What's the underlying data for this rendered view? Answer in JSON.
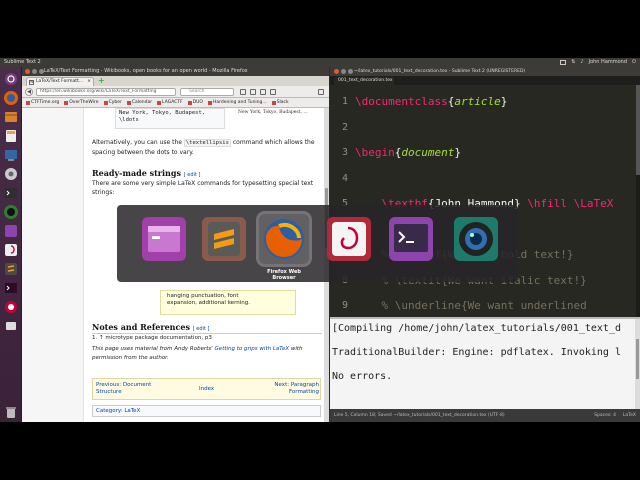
{
  "top_panel": {
    "app_title": "Sublime Text 2",
    "user": "John Hammond"
  },
  "firefox": {
    "window_title": "LaTeX/Text Formatting - Wikibooks, open books for an open world - Mozilla Firefox",
    "tab_label": "LaTeX/Text Formatt...",
    "tab_close": "×",
    "new_tab": "+",
    "url": "https://en.wikibooks.org/wiki/LaTeX/Text_Formatting",
    "search_placeholder": "Search",
    "bookmarks": [
      "CTFTime.org",
      "OverTheWire",
      "Cyber",
      "Calendar",
      "LAGACTF",
      "DUO",
      "Hardening and Tuning...",
      "Slack"
    ],
    "page": {
      "code_block": "New York, Tokyo, Budapest,\n\\ldots",
      "serif_output": "New York, Tokyo, Budapest, ...",
      "para_alt_1": "Alternatively, you can use the",
      "para_alt_code": "\\textellipsis",
      "para_alt_2": "command which allows the spacing between the dots to vary.",
      "ready_made_heading": "Ready-made strings",
      "edit_label": "[ edit ]",
      "ready_made_para": "There are some very simple LaTeX commands for typesetting special text strings:",
      "tip_line1": "hanging punctuation, font",
      "tip_line2": "expansion, additional kerning.",
      "notes_heading": "Notes and References",
      "ref_1": "1. ↑ microtype package documentation, p3",
      "attribution_1": "This page uses material from Andy Roberts'",
      "attribution_link": "Getting to grips with LaTeX",
      "attribution_2": "with permission from the author.",
      "nav_prev": "Previous: Document Structure",
      "nav_index": "Index",
      "nav_next": "Next: Paragraph Formatting",
      "category": "Category: LaTeX"
    }
  },
  "sublime": {
    "window_title": "~/latex_tutorials/001_text_decoration.tex - Sublime Text 2 (UNREGISTERED)",
    "tab_label": "001_text_decoration.tex",
    "code_lines": [
      {
        "num": "1",
        "parts": [
          [
            "kw",
            "\\documentclass"
          ],
          [
            "ind",
            "{"
          ],
          [
            "arg",
            "article"
          ],
          [
            "ind",
            "}"
          ]
        ]
      },
      {
        "num": "2",
        "parts": []
      },
      {
        "num": "3",
        "parts": [
          [
            "kw",
            "\\begin"
          ],
          [
            "ind",
            "{"
          ],
          [
            "arg",
            "document"
          ],
          [
            "ind",
            "}"
          ]
        ]
      },
      {
        "num": "4",
        "parts": []
      },
      {
        "num": "5",
        "parts": [
          [
            "ind",
            "    "
          ],
          [
            "kw",
            "\\textbf"
          ],
          [
            "ind",
            "{John Hammond} "
          ],
          [
            "kw",
            "\\hfill"
          ],
          [
            "ind",
            " "
          ],
          [
            "kw",
            "\\LaTeX"
          ]
        ]
      },
      {
        "num": "6",
        "parts": []
      },
      {
        "num": "7",
        "parts": [
          [
            "cm",
            "    % \\textbf{We want bold text!}"
          ]
        ]
      },
      {
        "num": "8",
        "parts": [
          [
            "cm",
            "    % \\textit{We want italic text!}"
          ]
        ]
      },
      {
        "num": "9",
        "parts": [
          [
            "cm",
            "    % \\underline{We want underlined"
          ]
        ]
      }
    ],
    "console": [
      "[Compiling /home/john/latex_tutorials/001_text_d",
      "",
      "TraditionalBuilder: Engine: pdflatex. Invoking l",
      "",
      "No errors."
    ],
    "status_left": "Line 5, Column 18; Saved ~/latex_tutorials/001_text_decoration.tex (UTF-8)",
    "status_spaces": "Spaces: 4",
    "status_syntax": "LaTeX"
  },
  "switcher": {
    "selected_label": "Firefox Web Browser",
    "apps": [
      "files-icon",
      "sublime-text-icon",
      "firefox-icon",
      "debian-icon",
      "terminal-icon",
      "camera-icon"
    ]
  },
  "colors": {
    "launcher": "#4a2d4a",
    "editor_bg": "#272822",
    "keyword": "#f92672",
    "argument": "#a6e22e",
    "comment": "#75715e"
  }
}
